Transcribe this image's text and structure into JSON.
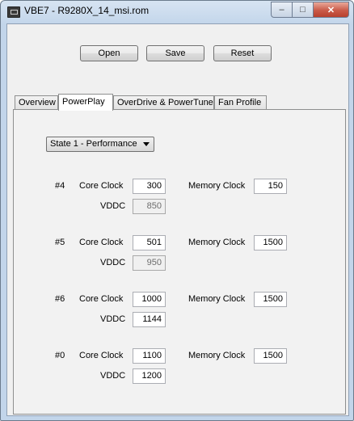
{
  "window": {
    "title": "VBE7 - R9280X_14_msi.rom",
    "minimize_glyph": "–",
    "maximize_glyph": "□",
    "close_glyph": "✕"
  },
  "toolbar": {
    "open_label": "Open",
    "save_label": "Save",
    "reset_label": "Reset"
  },
  "tabs": [
    {
      "label": "Overview",
      "active": false
    },
    {
      "label": "PowerPlay",
      "active": true
    },
    {
      "label": "OverDrive & PowerTune",
      "active": false
    },
    {
      "label": "Fan Profile",
      "active": false
    }
  ],
  "powerplay": {
    "state_selected": "State 1 - Performance",
    "core_clock_label": "Core Clock",
    "memory_clock_label": "Memory Clock",
    "vddc_label": "VDDC",
    "rows": [
      {
        "index": "#4",
        "core_clock": "300",
        "memory_clock": "150",
        "vddc": "850",
        "vddc_disabled": true
      },
      {
        "index": "#5",
        "core_clock": "501",
        "memory_clock": "1500",
        "vddc": "950",
        "vddc_disabled": true
      },
      {
        "index": "#6",
        "core_clock": "1000",
        "memory_clock": "1500",
        "vddc": "1144",
        "vddc_disabled": false
      },
      {
        "index": "#0",
        "core_clock": "1100",
        "memory_clock": "1500",
        "vddc": "1200",
        "vddc_disabled": false
      }
    ]
  }
}
